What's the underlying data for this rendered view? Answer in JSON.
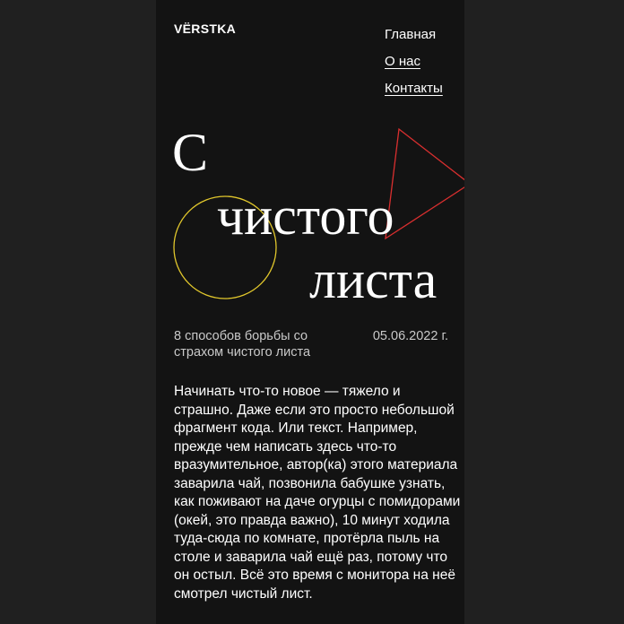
{
  "header": {
    "logo": "VЁRSTKA",
    "nav": [
      {
        "label": "Главная",
        "underlined": false
      },
      {
        "label": "О нас",
        "underlined": true
      },
      {
        "label": "Контакты",
        "underlined": true
      }
    ]
  },
  "hero": {
    "line1": "С",
    "line2": "чистого",
    "line3": "листа",
    "shapes": [
      {
        "shape": "circle",
        "color": "#e1c72c"
      },
      {
        "shape": "triangle",
        "color": "#d92f2f"
      }
    ]
  },
  "meta": {
    "subtitle": "8 способов борьбы со страхом чистого листа",
    "date": "05.06.2022 г."
  },
  "article": {
    "paragraph": "Начинать что-то новое — тяжело и страшно. Даже если это просто небольшой фрагмент кода. Или текст. Например, прежде чем написать здесь что-то вразумительное, автор(ка) этого материала заварила чай, позвонила бабушке узнать, как поживают на даче огурцы с помидорами (окей, это правда важно), 10 минут ходила туда-сюда по комнате, протёрла пыль на столе и заварила чай ещё раз, потому что он остыл. Всё это время с монитора на неё смотрел чистый лист."
  },
  "colors": {
    "page_background": "#131313",
    "outer_background": "#202020",
    "text": "#ffffff",
    "muted_text": "#c9c9c9",
    "circle_stroke": "#e1c72c",
    "triangle_stroke": "#d92f2f"
  }
}
